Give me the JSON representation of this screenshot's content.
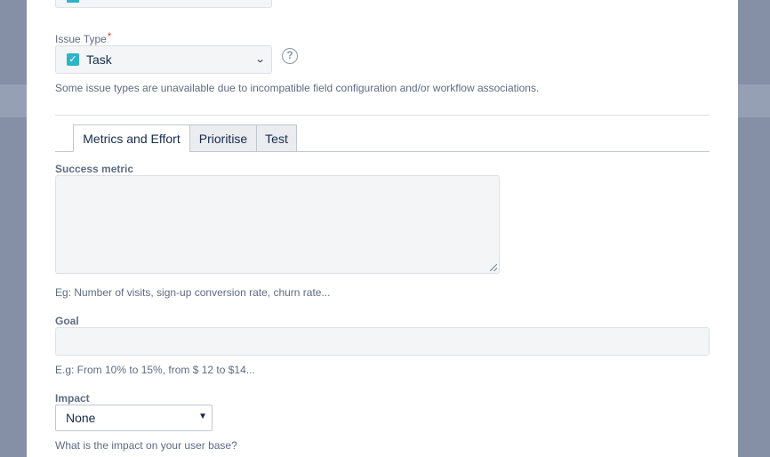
{
  "issue_type": {
    "label": "Issue Type",
    "required_mark": "*",
    "selected": "Task",
    "help_glyph": "?",
    "note": "Some issue types are unavailable due to incompatible field configuration and/or workflow associations."
  },
  "tabs": [
    {
      "label": "Metrics and Effort",
      "active": true
    },
    {
      "label": "Prioritise",
      "active": false
    },
    {
      "label": "Test",
      "active": false
    }
  ],
  "success_metric": {
    "label": "Success metric",
    "value": "",
    "hint": "Eg: Number of visits, sign-up conversion rate, churn rate..."
  },
  "goal": {
    "label": "Goal",
    "value": "",
    "hint": "E.g: From 10% to 15%, from $ 12 to $14..."
  },
  "impact": {
    "label": "Impact",
    "selected": "None",
    "hint": "What is the impact on your user base?"
  },
  "colors": {
    "backdrop": "#8590a6",
    "checkbox": "#2fb3c9",
    "required": "#de350b",
    "label": "#5e6c84",
    "text": "#172b4d"
  },
  "icons": {
    "checkbox": "check-icon",
    "chevron": "chevron-down-icon",
    "help": "question-circle-icon",
    "select_arrow": "triangle-down-icon"
  }
}
